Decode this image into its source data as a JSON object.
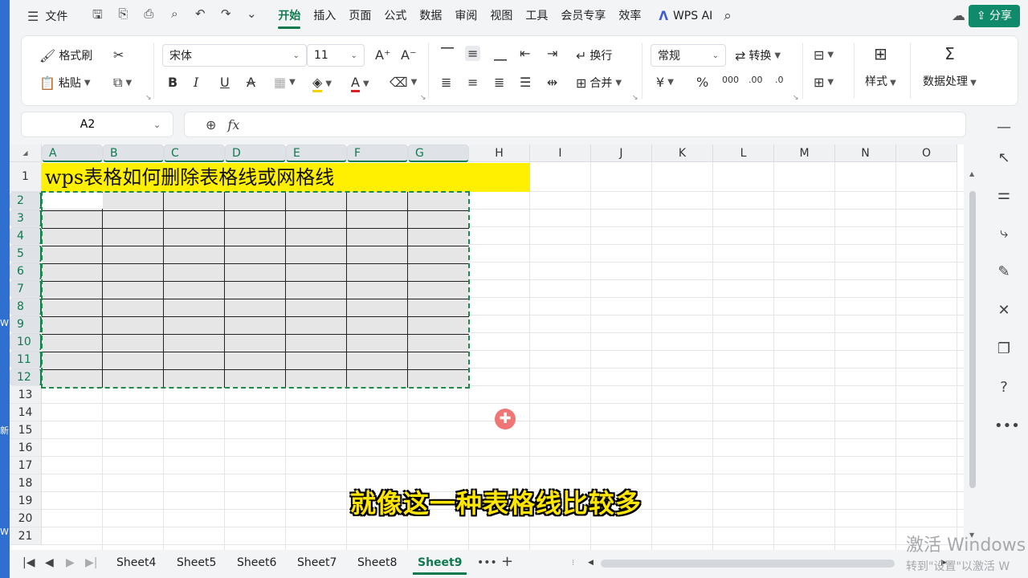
{
  "menu": {
    "file": "文件",
    "tabs": [
      "开始",
      "插入",
      "页面",
      "公式",
      "数据",
      "审阅",
      "视图",
      "工具",
      "会员专享",
      "效率"
    ],
    "active_tab": "开始",
    "wps_ai": "WPS AI",
    "share": "分享"
  },
  "ribbon": {
    "format_painter": "格式刷",
    "paste": "粘贴",
    "font_name": "宋体",
    "font_size": "11",
    "wrap": "换行",
    "merge": "合并",
    "number_format": "常规",
    "convert": "转换",
    "style": "样式",
    "data_process": "数据处理"
  },
  "formula_bar": {
    "name_box": "A2",
    "fx": "fx"
  },
  "sheet": {
    "columns": [
      "A",
      "B",
      "C",
      "D",
      "E",
      "F",
      "G",
      "H",
      "I",
      "J",
      "K",
      "L",
      "M",
      "N",
      "O"
    ],
    "rows": [
      "1",
      "2",
      "3",
      "4",
      "5",
      "6",
      "7",
      "8",
      "9",
      "10",
      "11",
      "12",
      "13",
      "14",
      "15",
      "16",
      "17",
      "18",
      "19",
      "20",
      "21"
    ],
    "title": "wps表格如何删除表格线或网格线"
  },
  "subtitle": "就像这一种表格线比较多",
  "sheet_tabs": [
    "Sheet4",
    "Sheet5",
    "Sheet6",
    "Sheet7",
    "Sheet8",
    "Sheet9"
  ],
  "active_sheet": "Sheet9",
  "more_label": "•••",
  "watermark": {
    "line1": "激活 Windows",
    "line2": "转到\"设置\"以激活 W"
  },
  "left_strip": [
    "W",
    "新",
    "W"
  ],
  "colors": {
    "accent": "#0f7a4d",
    "title_fill": "#ffef00",
    "share_button": "#0f8a6a",
    "subtitle_text": "#ffe600"
  }
}
